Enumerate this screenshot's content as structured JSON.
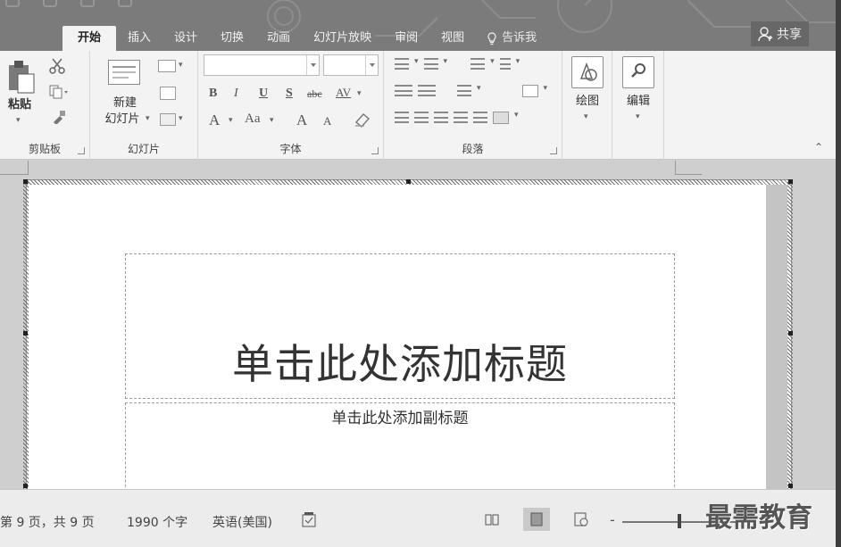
{
  "tabs": [
    {
      "label": "开始",
      "active": true
    },
    {
      "label": "插入"
    },
    {
      "label": "设计"
    },
    {
      "label": "切换"
    },
    {
      "label": "动画"
    },
    {
      "label": "幻灯片放映"
    },
    {
      "label": "审阅"
    },
    {
      "label": "视图"
    }
  ],
  "tell_me": "告诉我",
  "share": "共享",
  "ribbon": {
    "clipboard": {
      "paste": "粘贴",
      "label": "剪贴板"
    },
    "slides": {
      "new_slide_1": "新建",
      "new_slide_2": "幻灯片",
      "label": "幻灯片"
    },
    "font": {
      "label": "字体",
      "bold": "B",
      "italic": "I",
      "underline": "U",
      "shadow": "S",
      "strike": "abc",
      "spacing": "AV",
      "font_color": "A",
      "change_case": "Aa",
      "grow": "A",
      "shrink": "A"
    },
    "paragraph": {
      "label": "段落"
    },
    "drawing": {
      "label": "绘图"
    },
    "editing": {
      "label": "编辑"
    }
  },
  "slide": {
    "title_placeholder": "单击此处添加标题",
    "subtitle_placeholder": "单击此处添加副标题"
  },
  "status": {
    "page": "第 9 页，共 9 页",
    "words": "1990 个字",
    "language": "英语(美国)",
    "watermark": "最需教育"
  }
}
